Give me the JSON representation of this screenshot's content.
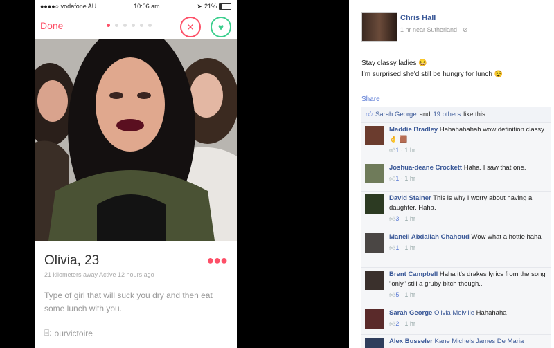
{
  "tinder": {
    "status": {
      "carrier": "●●●●○ vodafone AU",
      "time": "10:06 am",
      "battery": "21%",
      "battery_level": 0.21
    },
    "done_label": "Done",
    "profile": {
      "name": "Olivia, 23",
      "meta": "21 kilometers away  Active 12 hours ago",
      "bio": "Type of girl that will suck you dry and then eat some lunch with you.",
      "instagram": "ourvictoire"
    },
    "colors": {
      "accent": "#fd5068",
      "like": "#3ccf8e"
    }
  },
  "facebook": {
    "author": "Chris Hall",
    "meta": "1 hr near Sutherland · ⊘",
    "text_line1": "Stay classy ladies 😆",
    "text_line2": "I'm surprised she'd still be hungry for lunch 😵",
    "share": "Share",
    "likes": {
      "name": "Sarah George",
      "and": "and",
      "others": "19 others",
      "suffix": "like this."
    },
    "comments": [
      {
        "name": "Maddie Bradley",
        "text": "Hahahahahah wow definition classy 👌 🟫",
        "likes": "1",
        "time": "1 hr"
      },
      {
        "name": "Joshua-deane Crockett",
        "text": "Haha. I saw that one.",
        "likes": "1",
        "time": "1 hr"
      },
      {
        "name": "David Stainer",
        "text": "This is why I worry about having a daughter. Haha.",
        "likes": "3",
        "time": "1 hr"
      },
      {
        "name": "Manell Abdallah Chahoud",
        "text": "Wow what a hottie haha",
        "likes": "1",
        "time": "1 hr"
      },
      {
        "name": "Brent Campbell",
        "text": "Haha it's drakes lyrics from the song \"only\" still a gruby bitch though..",
        "likes": "5",
        "time": "1 hr"
      },
      {
        "name": "Sarah George",
        "tag": "Olivia Melville",
        "text": "Hahahaha",
        "likes": "2",
        "time": "1 hr"
      },
      {
        "name": "Alex Busseler",
        "tag": "Kane Michels James De Maria",
        "text": ""
      }
    ]
  }
}
